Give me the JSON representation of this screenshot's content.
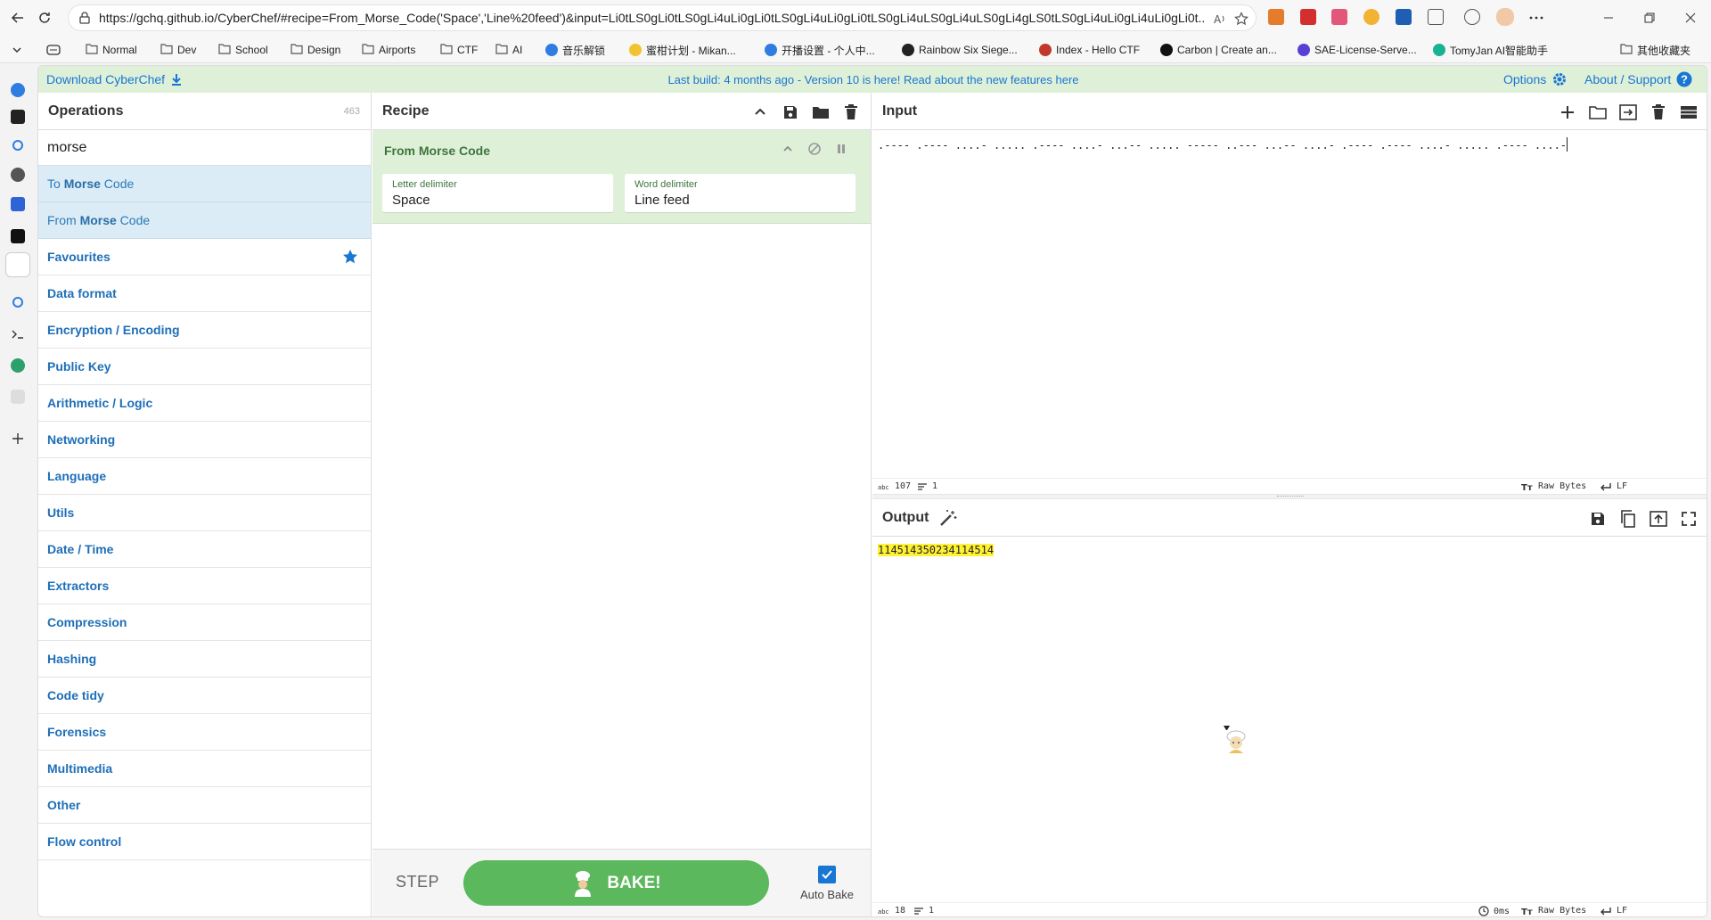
{
  "browser": {
    "url": "https://gchq.github.io/CyberChef/#recipe=From_Morse_Code('Space','Line%20feed')&input=Li0tLS0gLi0tLS0gLi4uLi0gLi0tLS0gLi4uLi0gLi0tLS0gLi4uLS0gLi4uLS0gLi4gLS0tLS0gLi4uLi0gLi4uLi0gLi0t...",
    "bookmarks": [
      {
        "label": "Normal",
        "icon": "folder-icon"
      },
      {
        "label": "Dev",
        "icon": "folder-icon"
      },
      {
        "label": "School",
        "icon": "folder-icon"
      },
      {
        "label": "Design",
        "icon": "folder-icon"
      },
      {
        "label": "Airports",
        "icon": "folder-icon"
      },
      {
        "label": "CTF",
        "icon": "folder-icon"
      },
      {
        "label": "AI",
        "icon": "folder-icon"
      },
      {
        "label": "音乐解锁",
        "icon": "site-icon"
      },
      {
        "label": "蜜柑计划 - Mikan...",
        "icon": "site-icon"
      },
      {
        "label": "开播设置 - 个人中...",
        "icon": "site-icon"
      },
      {
        "label": "Rainbow Six Siege...",
        "icon": "site-icon"
      },
      {
        "label": "Index - Hello CTF",
        "icon": "site-icon"
      },
      {
        "label": "Carbon | Create an...",
        "icon": "site-icon"
      },
      {
        "label": "SAE-License-Serve...",
        "icon": "site-icon"
      },
      {
        "label": "TomyJan AI智能助手",
        "icon": "site-icon"
      },
      {
        "label": "其他收藏夹",
        "icon": "folder-icon"
      }
    ]
  },
  "banner": {
    "download": "Download CyberChef",
    "center": "Last build: 4 months ago - Version 10 is here! Read about the new features here",
    "options": "Options",
    "about": "About / Support"
  },
  "operations": {
    "title": "Operations",
    "count": "463",
    "search_value": "morse",
    "results": [
      {
        "pre": "To ",
        "match": "Morse",
        "post": " Code"
      },
      {
        "pre": "From ",
        "match": "Morse",
        "post": " Code"
      }
    ],
    "categories": [
      "Favourites",
      "Data format",
      "Encryption / Encoding",
      "Public Key",
      "Arithmetic / Logic",
      "Networking",
      "Language",
      "Utils",
      "Date / Time",
      "Extractors",
      "Compression",
      "Hashing",
      "Code tidy",
      "Forensics",
      "Multimedia",
      "Other",
      "Flow control"
    ]
  },
  "recipe": {
    "title": "Recipe",
    "op_name": "From Morse Code",
    "args": [
      {
        "label": "Letter delimiter",
        "value": "Space"
      },
      {
        "label": "Word delimiter",
        "value": "Line feed"
      }
    ],
    "step": "STEP",
    "bake": "BAKE!",
    "auto_bake": "Auto Bake",
    "auto_bake_checked": true
  },
  "input": {
    "title": "Input",
    "text": ".---- .---- ....- ..... .---- ....- ...-- ..... ----- ..--- ...-- ....- .---- .---- ....- ..... .---- ....-",
    "length": "107",
    "lines": "1",
    "encoding": "Raw Bytes",
    "eol": "LF"
  },
  "output": {
    "title": "Output",
    "text": "114514350234114514",
    "length": "18",
    "lines": "1",
    "time": "0ms",
    "encoding": "Raw Bytes",
    "eol": "LF"
  },
  "colors": {
    "banner_bg": "#dff0d8",
    "link": "#1976d2",
    "op_card": "#dff0d8",
    "bake_green": "#5cb85c",
    "search_result": "#dbecf7",
    "output_highlight": "#fff134"
  }
}
